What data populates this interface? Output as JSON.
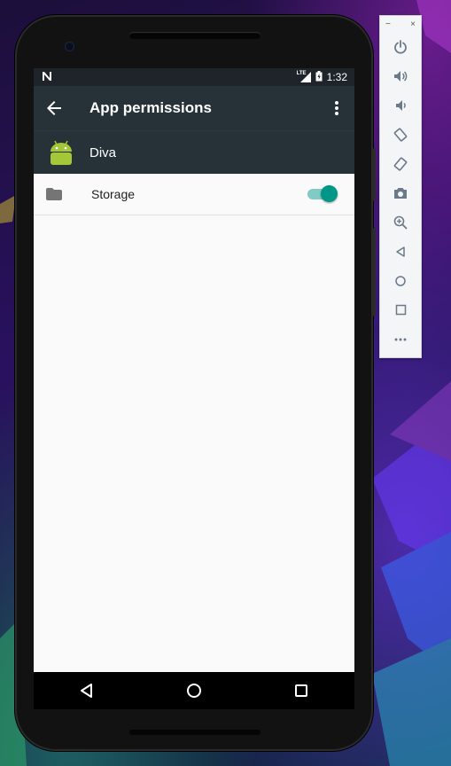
{
  "emulator_toolbar": {
    "minimize_label": "−",
    "close_label": "×",
    "tools": [
      "power-icon",
      "volume-up-icon",
      "volume-down-icon",
      "rotate-left-icon",
      "rotate-right-icon",
      "camera-icon",
      "zoom-icon",
      "back-icon",
      "home-icon",
      "overview-icon",
      "more-icon"
    ]
  },
  "status_bar": {
    "time": "1:32",
    "network": "LTE"
  },
  "app_bar": {
    "title": "App permissions"
  },
  "app_row": {
    "name": "Diva"
  },
  "permissions": [
    {
      "label": "Storage",
      "enabled": true
    }
  ],
  "colors": {
    "app_bar": "#263238",
    "accent": "#009688",
    "accent_track": "#80cbc4",
    "android_green": "#a4c639"
  }
}
